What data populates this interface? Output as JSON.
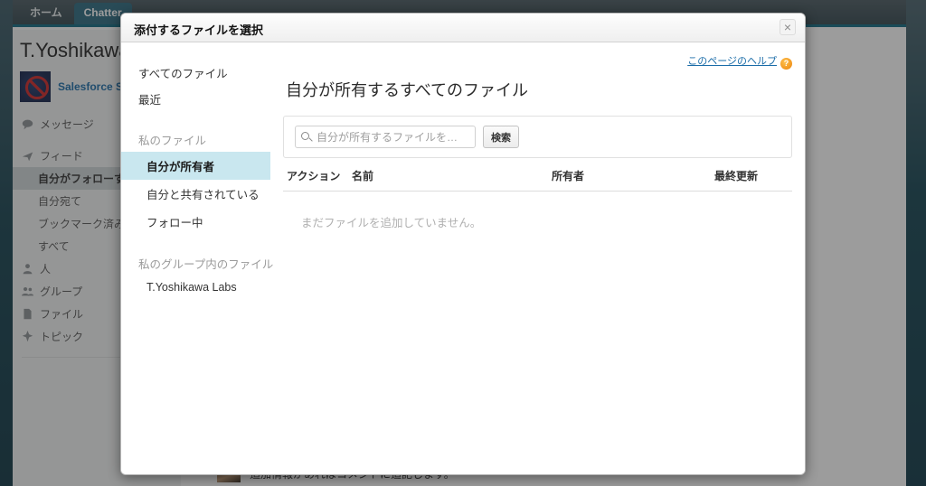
{
  "background": {
    "tabs": [
      {
        "label": "ホーム",
        "active": false
      },
      {
        "label": "Chatter",
        "active": true
      }
    ],
    "sidebar": {
      "user_title": "T.Yoshikawa",
      "profile_link": "Salesforce Sa",
      "messages_label": "メッセージ",
      "feed_label": "フィード",
      "feed_items": [
        "自分がフォローする",
        "自分宛て",
        "ブックマーク済み",
        "すべて"
      ],
      "nav_items": [
        "人",
        "グループ",
        "ファイル",
        "トピック"
      ]
    },
    "post_text": "追加情報があればコメントに追記します。"
  },
  "modal": {
    "title": "添付するファイルを選択",
    "close_label": "×",
    "sidebar": {
      "all_files": "すべてのファイル",
      "recent": "最近",
      "my_files_group": "私のファイル",
      "my_files_items": [
        {
          "label": "自分が所有者",
          "selected": true
        },
        {
          "label": "自分と共有されている",
          "selected": false
        },
        {
          "label": "フォロー中",
          "selected": false
        }
      ],
      "my_groups_group": "私のグループ内のファイル",
      "my_groups_items": [
        {
          "label": "T.Yoshikawa Labs",
          "selected": false
        }
      ]
    },
    "content": {
      "help_link": "このページのヘルプ",
      "help_icon_glyph": "?",
      "title": "自分が所有するすべてのファイル",
      "search_placeholder": "自分が所有するファイルを…",
      "search_value": "",
      "search_button": "検索",
      "table_headers": {
        "action": "アクション",
        "name": "名前",
        "owner": "所有者",
        "modified": "最終更新"
      },
      "empty_message": "まだファイルを追加していません。"
    }
  },
  "colors": {
    "accent_teal": "#0f6a82",
    "selected_blue": "#c9e7ef",
    "link_blue": "#1a6ca8",
    "help_orange": "#f0921a"
  }
}
